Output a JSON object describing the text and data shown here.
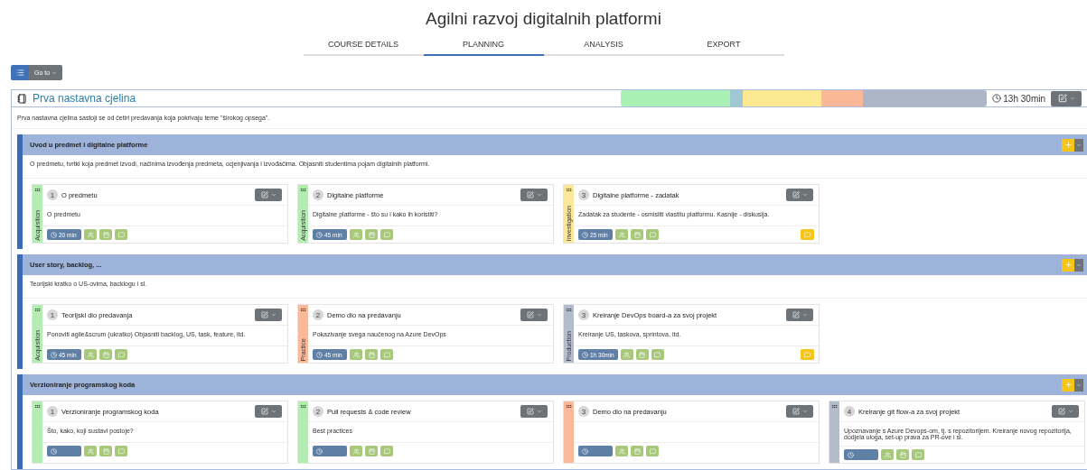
{
  "title": "Agilni razvoj digitalnih platformi",
  "tabs": [
    {
      "label": "COURSE DETAILS",
      "selected": false
    },
    {
      "label": "PLANNING",
      "selected": true
    },
    {
      "label": "ANALYSIS",
      "selected": false
    },
    {
      "label": "EXPORT",
      "selected": false
    }
  ],
  "goto": {
    "label": "Go to"
  },
  "unit": {
    "title": "Prva nastavna cjelina",
    "total": "13h 30min",
    "description": "Prva nastavna cjelina sastoji se od četiri predavanja koja pokrivaju teme \"širokog opsega\".",
    "distribution_bar": true
  },
  "sections": [
    {
      "title": "Uvod u predmet i digitalne platforme",
      "description": "O predmetu, tvrtki koja predmet izvodi, načinima izvođenja predmeta, ocjenjivanja i izvođačima. Objasniti studentima pojam digitalnih platformi.",
      "cards": [
        {
          "kind": "acquisition",
          "label": "Acquisition",
          "number": "1",
          "title": "O predmetu",
          "text": "O predmetu",
          "duration": "20 min",
          "comment": false
        },
        {
          "kind": "acquisition",
          "label": "Acquisition",
          "number": "2",
          "title": "Digitalne platforme",
          "text": "Digitalne platforme - što su i kako ih koristiti?",
          "duration": "45 min",
          "comment": false
        },
        {
          "kind": "investigation",
          "label": "Investigation",
          "number": "3",
          "title": "Digitalne platforme - zadatak",
          "text": "Zadatak za studente - osmisliti vlastitu platformu. Kasnije - diskusija.",
          "duration": "25 min",
          "comment": true
        }
      ]
    },
    {
      "title": "User story, backlog, ...",
      "description": "Teorijski kratko o US-ovima, backlogu i sl.",
      "cards": [
        {
          "kind": "acquisition",
          "label": "Acquisition",
          "number": "1",
          "title": "Teorijski dio predavanja",
          "text": "Ponoviti agile&scrum (ukratko) Objasniti backlog, US, task, feature, itd.",
          "duration": "45 min",
          "comment": false
        },
        {
          "kind": "practice",
          "label": "Practice",
          "number": "2",
          "title": "Demo dio na predavanju",
          "text": "Pokazivanje svega naučenog na Azure DevOps",
          "duration": "45 min",
          "comment": false
        },
        {
          "kind": "production",
          "label": "Production",
          "number": "3",
          "title": "Kreiranje DevOps board-a za svoj projekt",
          "text": "Kreiranje US, taskova, sprintova, itd.",
          "duration": "1h 30min",
          "comment": true
        }
      ]
    },
    {
      "title": "Verzioniranje programskog koda",
      "cards": [
        {
          "kind": "acquisition",
          "number": "1",
          "title": "Verzioniranje programskog koda",
          "text": "Što, kako, koji sustavi postoje?"
        },
        {
          "kind": "acquisition",
          "number": "2",
          "title": "Pull requests & code review",
          "text": "Best practices"
        },
        {
          "kind": "practice",
          "number": "3",
          "title": "Demo dio na predavanju"
        },
        {
          "kind": "production",
          "number": "4",
          "title": "Kreiranje git flow-a za svoj projekt",
          "text": "Upoznavanje s Azure Devops-om, tj. s repozitorijem. Kreiranje novog repozitorija, dodjela uloga, set-up prava za PR-ove i sl."
        }
      ]
    }
  ]
}
